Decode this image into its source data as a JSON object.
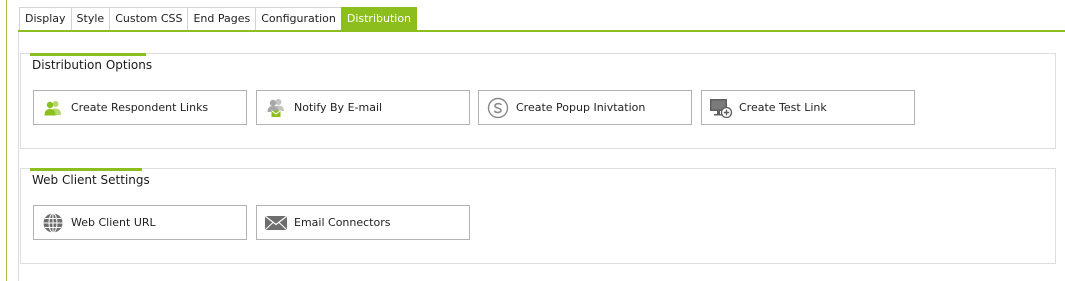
{
  "tabs": [
    {
      "label": "Display",
      "active": false
    },
    {
      "label": "Style",
      "active": false
    },
    {
      "label": "Custom CSS",
      "active": false
    },
    {
      "label": "End Pages",
      "active": false
    },
    {
      "label": "Configuration",
      "active": false
    },
    {
      "label": "Distribution",
      "active": true
    }
  ],
  "colors": {
    "accent": "#8cbe1e",
    "border": "#b2b2b2",
    "icon_gray": "#8a8a8a"
  },
  "distribution_options": {
    "title": "Distribution Options",
    "buttons": [
      {
        "label": "Create Respondent Links",
        "icon": "respondents-icon"
      },
      {
        "label": "Notify By E-mail",
        "icon": "email-notify-icon"
      },
      {
        "label": "Create Popup Inivtation",
        "icon": "skype-popup-icon"
      },
      {
        "label": "Create Test Link",
        "icon": "monitor-plus-icon"
      }
    ]
  },
  "web_client_settings": {
    "title": "Web Client Settings",
    "buttons": [
      {
        "label": "Web Client URL",
        "icon": "globe-icon"
      },
      {
        "label": "Email Connectors",
        "icon": "envelope-icon"
      }
    ]
  }
}
